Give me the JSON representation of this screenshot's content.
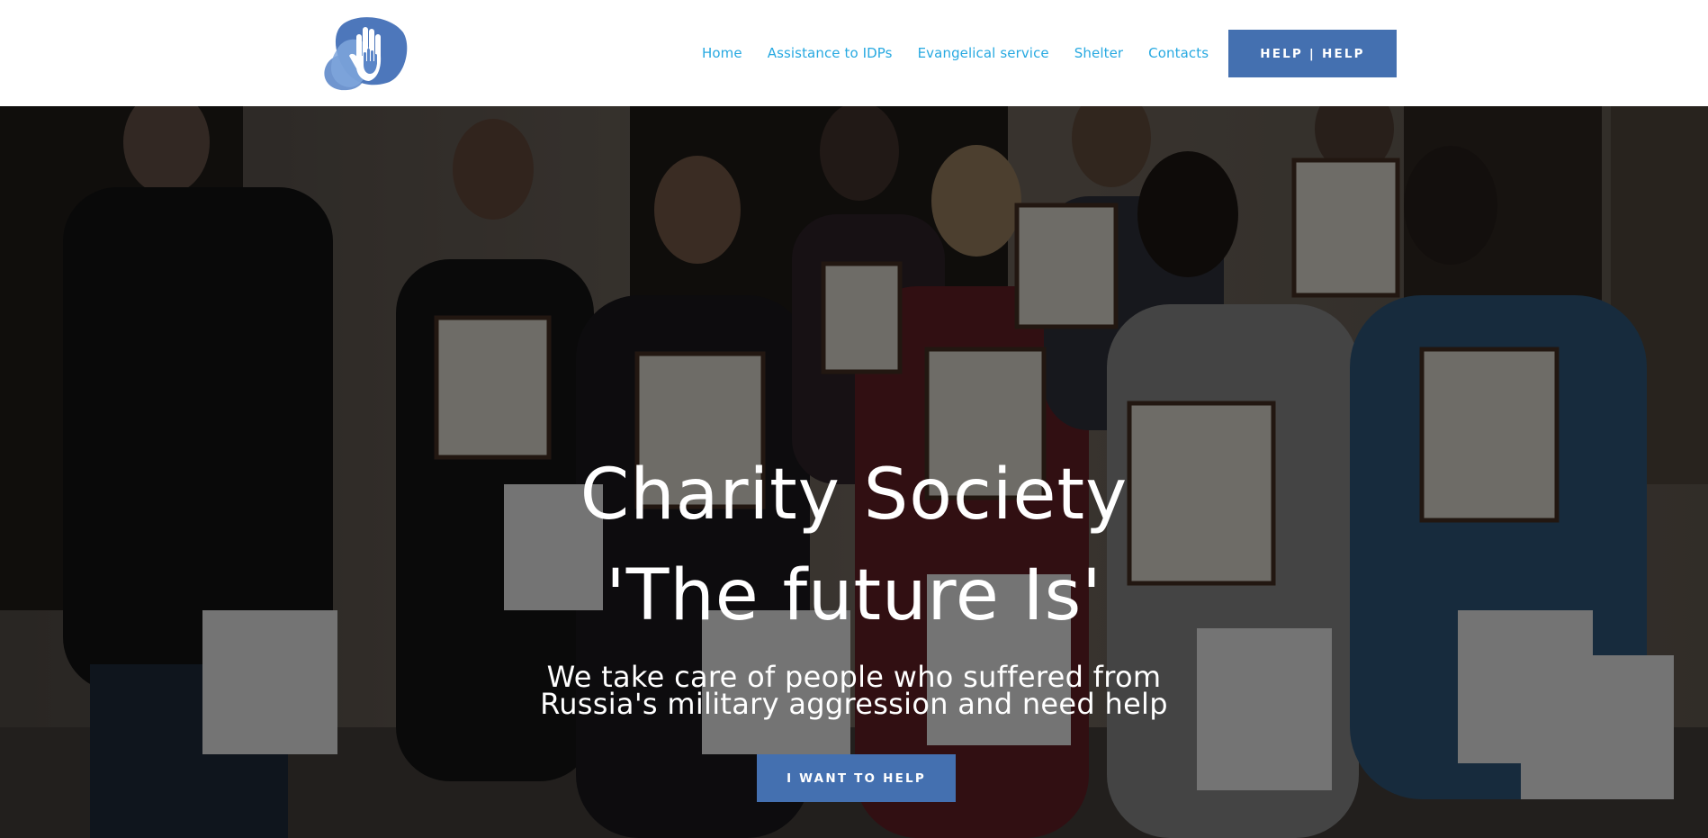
{
  "header": {
    "logo_icon": "hand-in-hand-icon",
    "nav": [
      {
        "label": "Home"
      },
      {
        "label": "Assistance to IDPs"
      },
      {
        "label": "Evangelical service"
      },
      {
        "label": "Shelter"
      },
      {
        "label": "Contacts"
      }
    ],
    "help_button": "HELP | HELP"
  },
  "hero": {
    "title_line1": "Charity Society",
    "title_line2": "'The future Is'",
    "subtitle_line1": "We take care of people who suffered from",
    "subtitle_line2": "Russia's military aggression and need help",
    "cta_button": "I WANT TO HELP"
  },
  "colors": {
    "accent": "#4470b0",
    "nav_link": "#27a9e1",
    "logo_light": "#7fa6dc",
    "logo_dark": "#4d77bb"
  }
}
